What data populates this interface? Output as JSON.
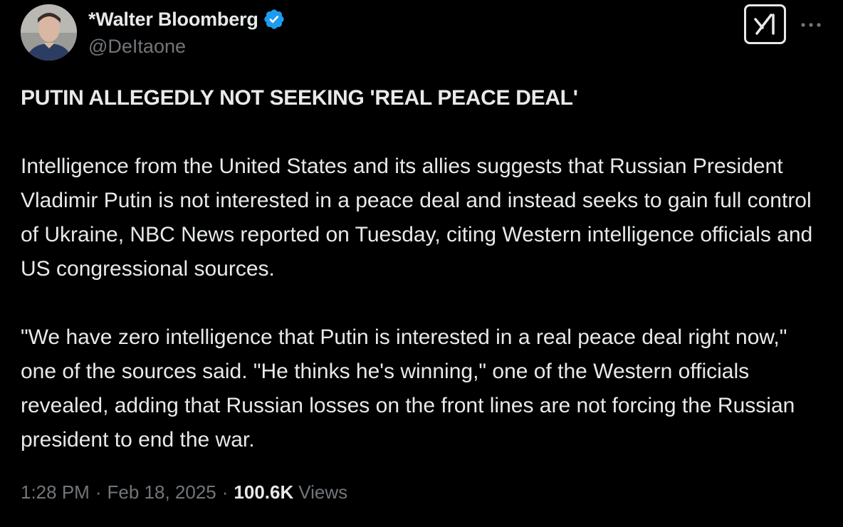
{
  "author": {
    "name": "*Walter Bloomberg",
    "handle": "@DeItaone",
    "verified": true,
    "verified_color": "#1d9bf0",
    "avatar_icon": "profile-photo"
  },
  "actions": {
    "grok_icon": "grok-icon",
    "more_icon": "more-horizontal-icon"
  },
  "tweet": {
    "headline": "PUTIN ALLEGEDLY NOT SEEKING 'REAL PEACE DEAL'",
    "paragraph_1": "Intelligence from the United States and its allies suggests that Russian President Vladimir Putin is not interested in a peace deal and instead seeks to gain full control of Ukraine, NBC News reported on Tuesday, citing Western intelligence officials and US congressional sources.",
    "paragraph_2": "\"We have zero intelligence that Putin is interested in a real peace deal right now,\" one of the sources said. \"He thinks he's winning,\" one of the Western officials revealed, adding that Russian losses on the front lines are not forcing the Russian president to end the war."
  },
  "meta": {
    "time": "1:28 PM",
    "separator": "·",
    "date": "Feb 18, 2025",
    "views_count": "100.6K",
    "views_label": "Views"
  },
  "colors": {
    "background": "#000000",
    "text_primary": "#e7e9ea",
    "text_secondary": "#71767b",
    "accent": "#1d9bf0"
  }
}
